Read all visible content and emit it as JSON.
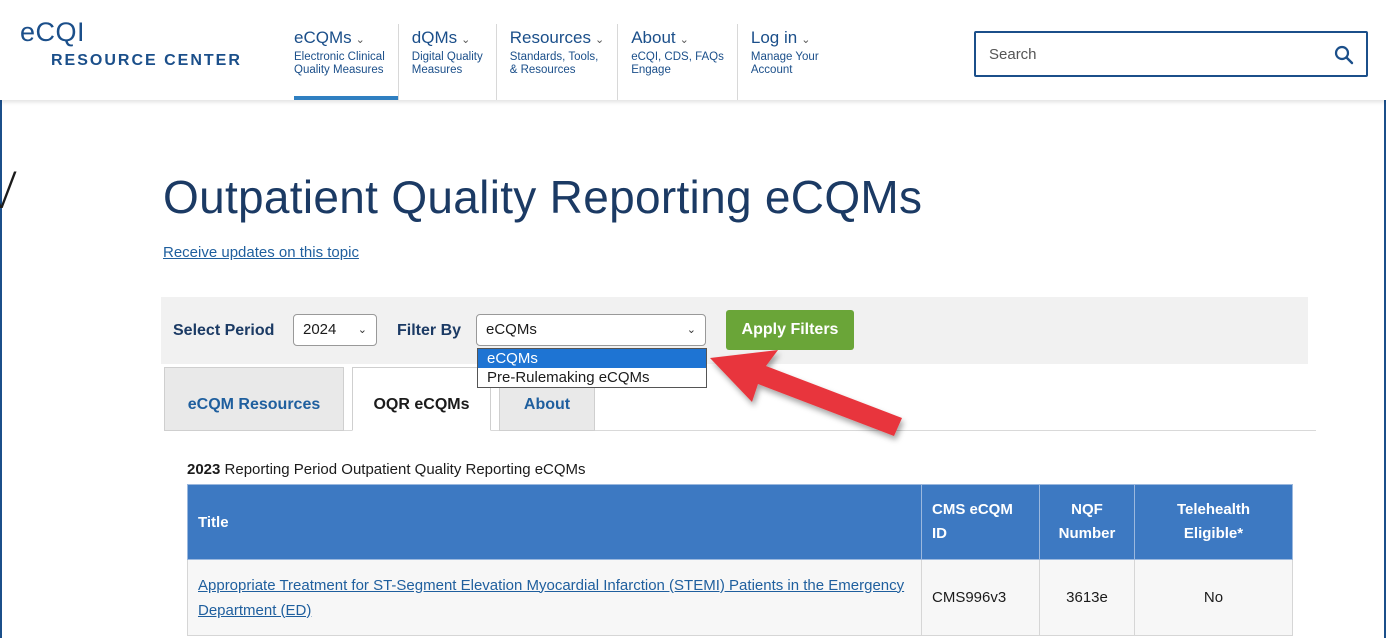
{
  "header": {
    "logo_top": "eCQI",
    "logo_bottom": "RESOURCE CENTER",
    "nav": [
      {
        "title": "eCQMs",
        "sub": "Electronic Clinical\nQuality Measures"
      },
      {
        "title": "dQMs",
        "sub": "Digital Quality\nMeasures"
      },
      {
        "title": "Resources",
        "sub": "Standards, Tools,\n& Resources"
      },
      {
        "title": "About",
        "sub": "eCQI, CDS, FAQs\nEngage"
      },
      {
        "title": "Log in",
        "sub": "Manage Your\nAccount"
      }
    ],
    "nav_chevron": "⌄",
    "search_placeholder": "Search"
  },
  "edge_glyph": "V",
  "page": {
    "title": "Outpatient Quality Reporting eCQMs",
    "updates_link": "Receive updates on this topic"
  },
  "filters": {
    "period_label": "Select Period",
    "period_value": "2024",
    "filter_label": "Filter By",
    "filter_value": "eCQMs",
    "apply_label": "Apply Filters",
    "options": [
      "eCQMs",
      "Pre-Rulemaking eCQMs"
    ]
  },
  "tabs": [
    "eCQM Resources",
    "OQR eCQMs",
    "About"
  ],
  "table": {
    "caption_year": "2023",
    "caption_text": " Reporting Period Outpatient Quality Reporting eCQMs",
    "headers": {
      "title": "Title",
      "cms_line1": "CMS eCQM",
      "cms_line2": "ID",
      "nqf_line1": "NQF",
      "nqf_line2": "Number",
      "tele_line1": "Telehealth",
      "tele_line2": "Eligible*"
    },
    "rows": [
      {
        "title": "Appropriate Treatment for ST-Segment Elevation Myocardial Infarction (STEMI) Patients in the Emergency Department (ED)",
        "cms_id": "CMS996v3",
        "nqf": "3613e",
        "telehealth": "No"
      }
    ]
  },
  "colors": {
    "brand_blue": "#1b4f8a",
    "table_header": "#3d79c2",
    "apply_green": "#6aa538",
    "annotation_arrow": "#e8363c"
  }
}
